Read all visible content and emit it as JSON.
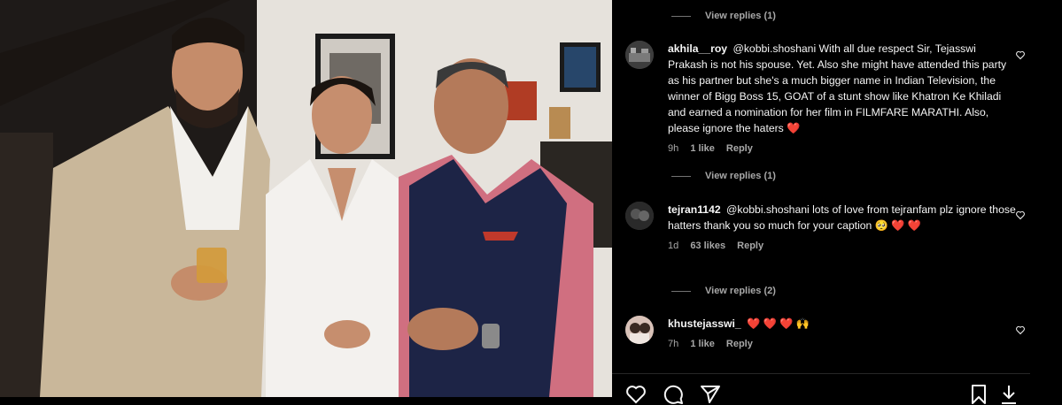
{
  "comments": [
    {
      "username": "akhila__roy",
      "text": "@kobbi.shoshani With all due respect Sir, Tejasswi Prakash is not his spouse. Yet. Also she might have attended this party as his partner but she's a much bigger name in Indian Television, the winner of Bigg Boss 15, GOAT of a stunt show like Khatron Ke Khiladi and earned a nomination for her film in FILMFARE MARATHI. Also, please ignore the haters ❤️",
      "time": "9h",
      "likes": "1 like",
      "reply": "Reply",
      "view_replies": "View replies (1)"
    },
    {
      "username": "tejran1142",
      "text": "@kobbi.shoshani lots of love from tejranfam plz ignore those hatters thank you so much for your caption 🥺 ❤️ ❤️",
      "time": "1d",
      "likes": "63 likes",
      "reply": "Reply",
      "view_replies": "View replies (2)"
    },
    {
      "username": "khustejasswi_",
      "text": "❤️ ❤️ ❤️ 🙌",
      "time": "7h",
      "likes": "1 like",
      "reply": "Reply"
    }
  ],
  "top_view_replies": "View replies (1)",
  "icons": [
    "heart-icon",
    "comment-icon",
    "share-icon",
    "bookmark-icon",
    "download-icon"
  ],
  "colors": {
    "background": "#000000",
    "secondary_text": "#a8a8a8",
    "primary_text": "#f5f5f5"
  }
}
